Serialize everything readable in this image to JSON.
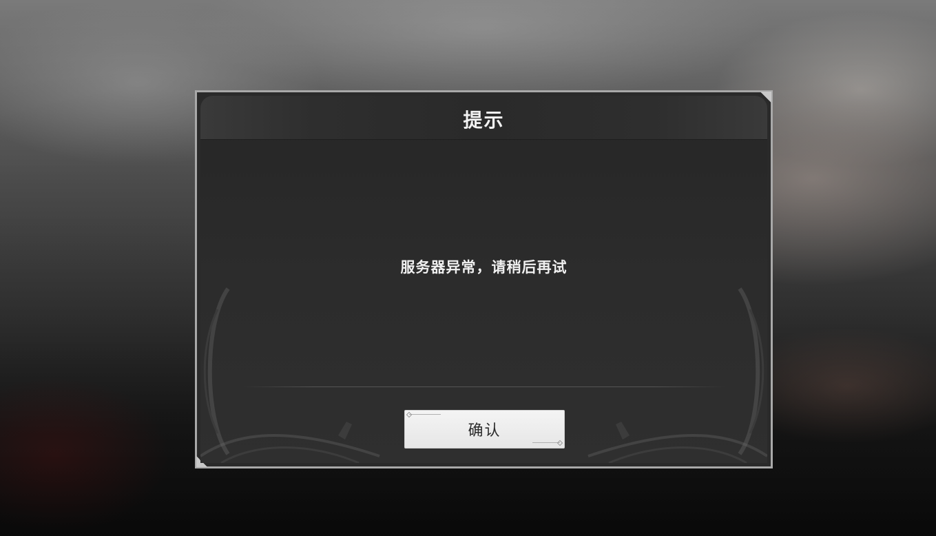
{
  "dialog": {
    "title": "提示",
    "message": "服务器异常，请稍后再试",
    "confirm_label": "确认"
  },
  "colors": {
    "dialog_border": "#a9a9a9",
    "dialog_bg": "#2a2a2a",
    "text_light": "#f0f0f0",
    "button_bg": "#f0f0f0",
    "button_text": "#2b2b2b"
  }
}
